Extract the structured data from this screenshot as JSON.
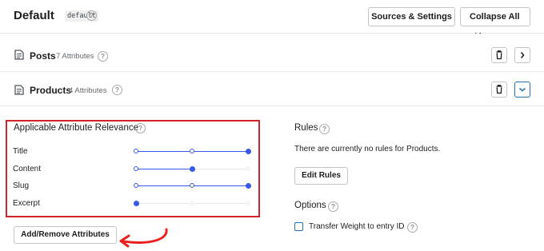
{
  "engine": {
    "title": "Default",
    "slug": "default",
    "help": "?"
  },
  "header": {
    "sources_button": "Sources & Settings",
    "collapse_button": "Collapse All"
  },
  "sources": [
    {
      "title": "Posts",
      "count": "7 Attributes",
      "expanded": false
    },
    {
      "title": "Products",
      "count": "4 Attributes",
      "expanded": true
    }
  ],
  "relevance": {
    "heading": "Applicable Attribute Relevance",
    "attributes": [
      {
        "label": "Title",
        "level_percent": 100
      },
      {
        "label": "Content",
        "level_percent": 50
      },
      {
        "label": "Slug",
        "level_percent": 100
      },
      {
        "label": "Excerpt",
        "level_percent": 0
      }
    ],
    "add_remove_button": "Add/Remove Attributes"
  },
  "rules": {
    "heading": "Rules",
    "empty_text": "There are currently no rules for Products.",
    "edit_button": "Edit Rules"
  },
  "options": {
    "heading": "Options",
    "transfer_weight_label": "Transfer Weight to entry ID",
    "transfer_weight_checked": false
  },
  "colors": {
    "highlight_box": "#d0232a",
    "slider_accent": "#3858e9",
    "arrow": "#e8231f"
  }
}
